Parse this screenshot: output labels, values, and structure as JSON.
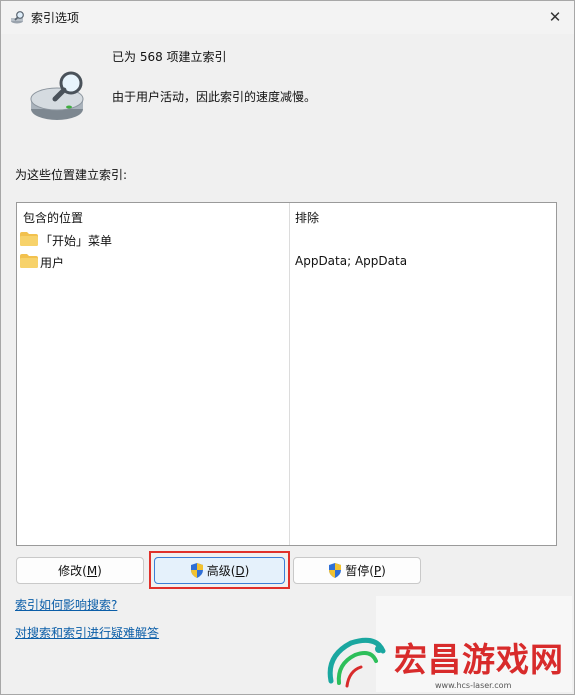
{
  "window": {
    "title": "索引选项",
    "close_glyph": "✕"
  },
  "status": {
    "count_text": "已为 568 项建立索引",
    "state_text": "由于用户活动，因此索引的速度减慢。"
  },
  "locations": {
    "label": "为这些位置建立索引:",
    "col_included": "包含的位置",
    "col_exclude": "排除",
    "rows": [
      {
        "name": "「开始」菜单",
        "exclude": ""
      },
      {
        "name": "用户",
        "exclude": "AppData; AppData"
      }
    ]
  },
  "buttons": {
    "modify": {
      "label": "修改(",
      "mnemonic": "M",
      "suffix": ")"
    },
    "advanced": {
      "label": "高级(",
      "mnemonic": "D",
      "suffix": ")"
    },
    "pause": {
      "label": "暂停(",
      "mnemonic": "P",
      "suffix": ")"
    }
  },
  "links": {
    "how_affects": "索引如何影响搜索?",
    "troubleshoot": "对搜索和索引进行疑难解答"
  },
  "watermark": {
    "title": "宏昌游戏网",
    "url": "www.hcs-laser.com"
  },
  "colors": {
    "accent": "#3b7ed6",
    "highlight": "#e0302a",
    "link": "#0b5ea8",
    "watermark": "#d82b2b"
  }
}
